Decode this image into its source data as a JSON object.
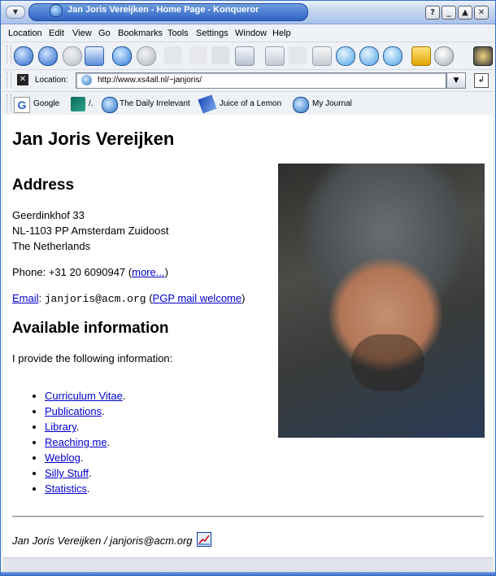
{
  "window": {
    "title": "Jan Joris Vereijken - Home Page - Konqueror",
    "controls": {
      "help": "?",
      "minimize": "_",
      "maximize": "▲",
      "close": "✕"
    }
  },
  "menubar": [
    "Location",
    "Edit",
    "View",
    "Go",
    "Bookmarks",
    "Tools",
    "Settings",
    "Window",
    "Help"
  ],
  "toolbar": {
    "icons": [
      "up-icon",
      "back-icon",
      "forward-icon",
      "home-icon",
      "reload-icon",
      "stop-icon",
      "cut-icon",
      "copy-icon",
      "paste-icon",
      "print-icon",
      "new-tab-icon",
      "close-tab-icon",
      "find-icon",
      "zoom-in-icon",
      "zoom-out-icon",
      "lock-icon",
      "download-icon"
    ]
  },
  "location_bar": {
    "label": "Location:",
    "url": "http://www.xs4all.nl/~janjoris/"
  },
  "bookmarks": [
    {
      "label": "Google",
      "icon": "google-icon"
    },
    {
      "label": "/.",
      "icon": "slashdot-icon"
    },
    {
      "label": "The Daily Irrelevant",
      "icon": "konqueror-icon"
    },
    {
      "label": "Juice of a Lemon",
      "icon": "pen-icon"
    },
    {
      "label": "My Journal",
      "icon": "konqueror-icon"
    }
  ],
  "page": {
    "heading": "Jan Joris Vereijken",
    "address_heading": "Address",
    "address_lines": [
      "Geerdinkhof 33",
      "NL-1103 PP Amsterdam Zuidoost",
      "The Netherlands"
    ],
    "phone_prefix": "Phone: +31 20 6090947 (",
    "phone_more": "more...",
    "phone_suffix": ")",
    "email_link": "Email",
    "email_sep": ": ",
    "email_address": "janjoris@acm.org",
    "pgp_open": " (",
    "pgp_link": "PGP mail welcome",
    "pgp_close": ")",
    "available_heading": "Available information",
    "intro": "I provide the following information:",
    "links": [
      "Curriculum Vitae",
      "Publications",
      "Library",
      "Reaching me",
      "Weblog",
      "Silly Stuff",
      "Statistics"
    ],
    "footer": "Jan Joris Vereijken / janjoris@acm.org"
  }
}
